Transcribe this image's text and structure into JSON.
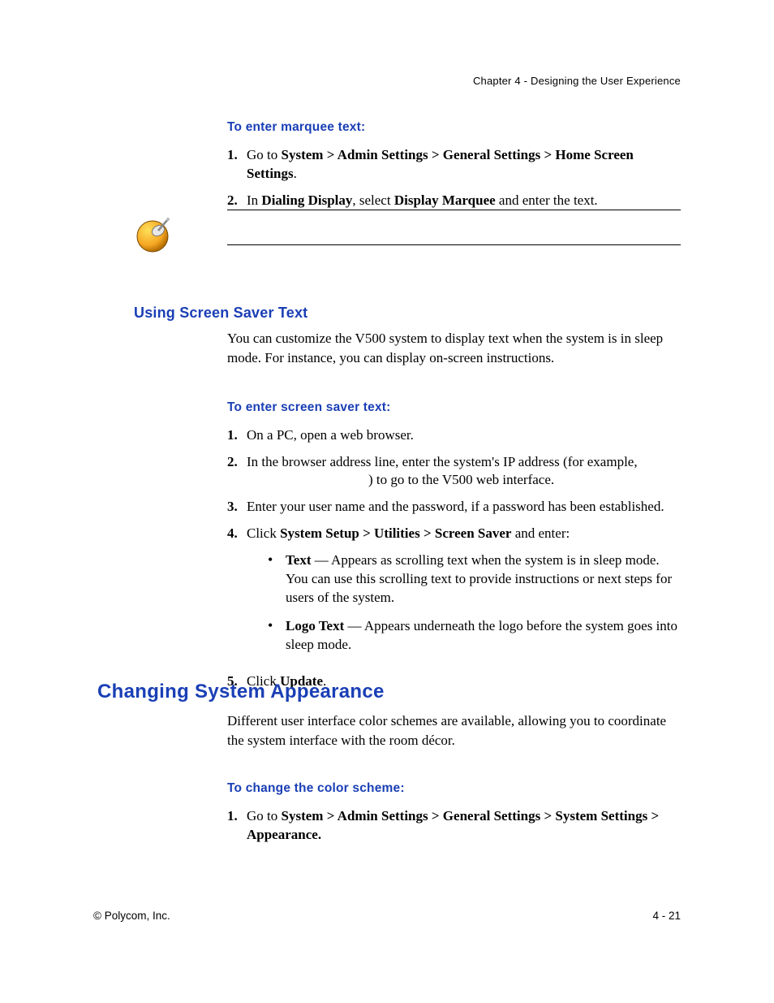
{
  "running_head": "Chapter 4 - Designing the User Experience",
  "section_marquee": {
    "heading": "To enter marquee text:",
    "steps": [
      {
        "num": "1.",
        "pre": "Go to ",
        "bold": "System > Admin Settings > General Settings > Home Screen Settings",
        "post": "."
      },
      {
        "num": "2.",
        "pre": "In ",
        "bold": "Dialing Display",
        "mid": ", select ",
        "bold2": "Display Marquee",
        "post": " and enter the text."
      }
    ]
  },
  "section_screensaver": {
    "subheading": "Using Screen Saver Text",
    "intro": "You can customize the V500 system to display text when the system is in sleep mode. For instance, you can display on-screen instructions.",
    "task_heading": "To enter screen saver text:",
    "steps": [
      {
        "num": "1.",
        "text": "On a PC, open a web browser."
      },
      {
        "num": "2.",
        "text_a": "In the browser address line, enter the system's IP address (for example, ",
        "text_b": ") to go to the V500 web interface."
      },
      {
        "num": "3.",
        "text": "Enter your user name and the password, if a password has been established."
      },
      {
        "num": "4.",
        "pre": "Click ",
        "bold": "System Setup > Utilities > Screen Saver",
        "post": " and enter:"
      },
      {
        "num": "5.",
        "pre": "Click ",
        "bold": "Update",
        "post": "."
      }
    ],
    "bullets": [
      {
        "lead": "Text",
        "rest": " — Appears as scrolling text when the system is in sleep mode. You can use this scrolling text to provide instructions or next steps for users of the system."
      },
      {
        "lead": "Logo Text",
        "rest": " — Appears underneath the logo before the system goes into sleep mode."
      }
    ]
  },
  "section_appearance": {
    "h1": "Changing System Appearance",
    "intro": "Different user interface color schemes are available, allowing you to coordinate the system interface with the room décor.",
    "task_heading": "To change the color scheme:",
    "step": {
      "num": "1.",
      "pre": "Go to ",
      "bold": "System > Admin Settings > General Settings > System Settings > Appearance."
    }
  },
  "footer": {
    "left": "© Polycom, Inc.",
    "right": "4 - 21"
  }
}
